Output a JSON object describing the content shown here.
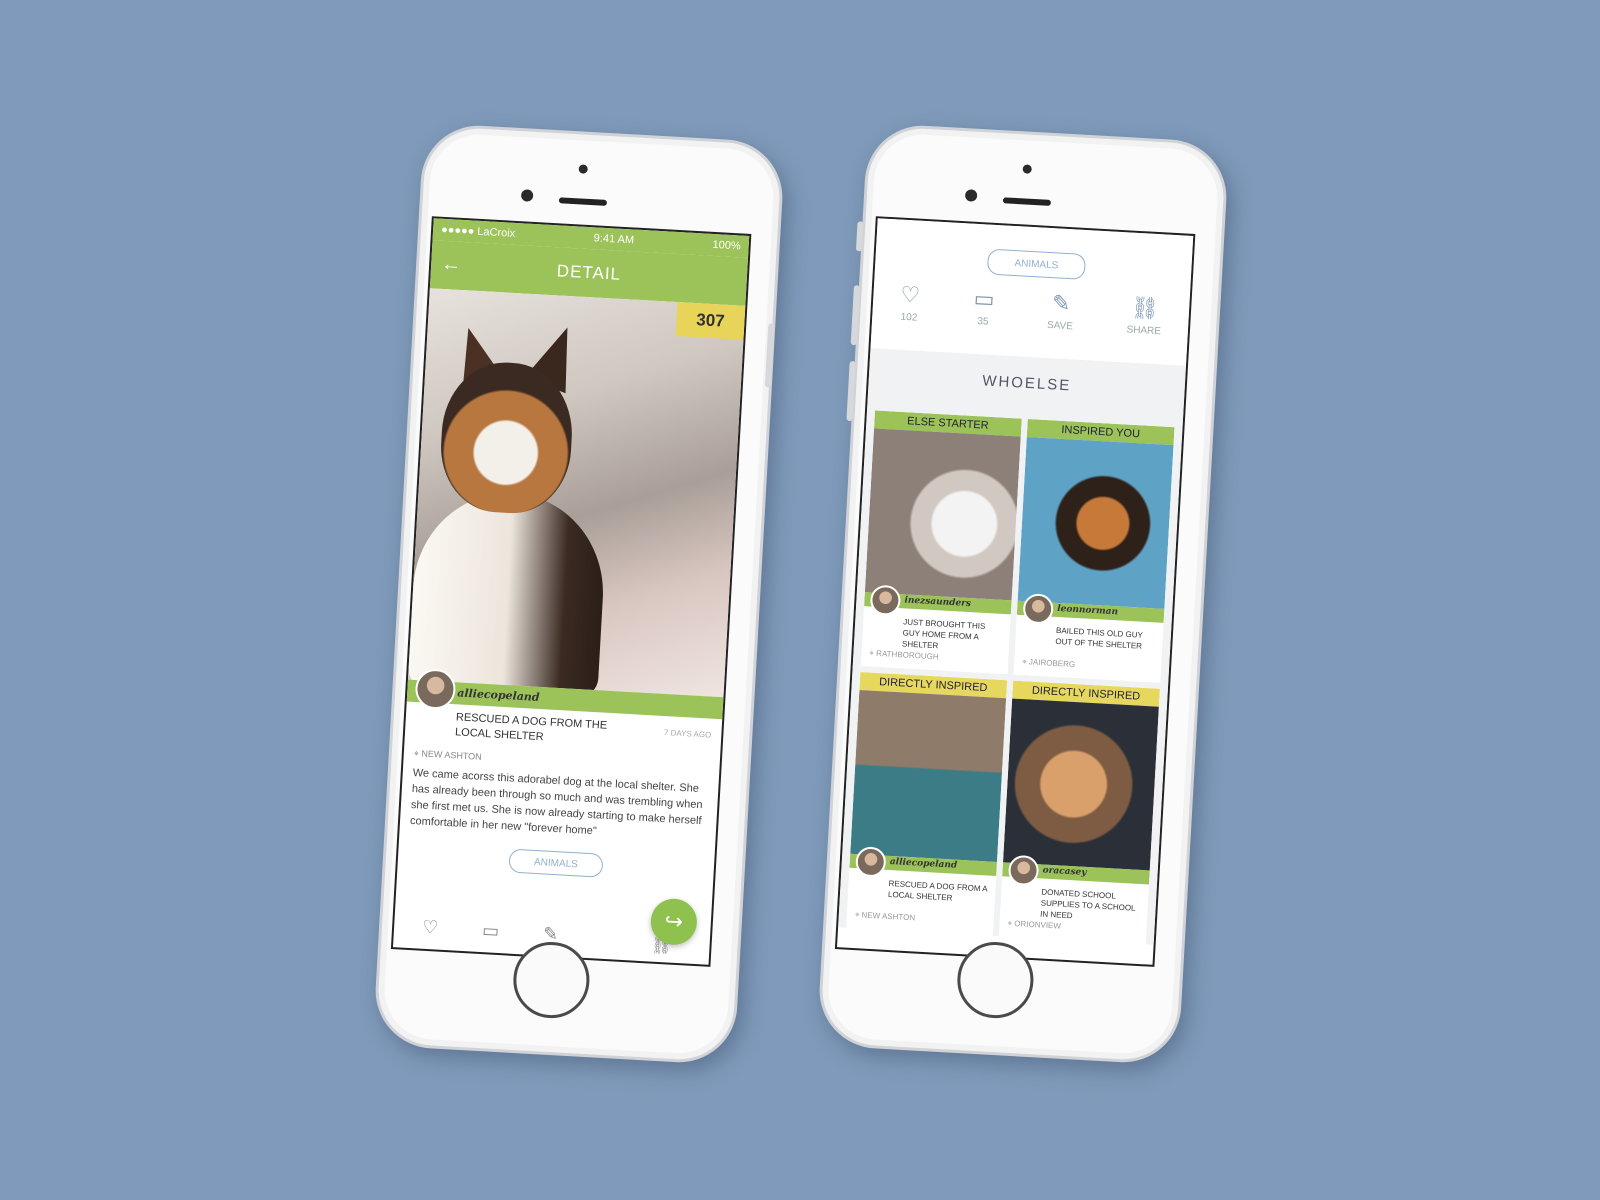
{
  "left_phone": {
    "status": {
      "carrier": "●●●●● LaCroix",
      "time": "9:41 AM",
      "battery": "100%"
    },
    "nav_title": "DETAIL",
    "score": "307",
    "post": {
      "username": "alliecopeland",
      "title": "RESCUED A DOG FROM THE LOCAL SHELTER",
      "time_ago": "7 DAYS AGO",
      "location": "NEW ASHTON",
      "body": "We came acorss this adorabel dog at the local shelter. She has already been through so much and was trembling when she first met us. She is now already starting to make herself comfortable in her new \"forever home\"",
      "tag": "ANIMALS"
    },
    "icons": [
      "heart-icon",
      "comment-icon",
      "pin-icon",
      "share-icon"
    ],
    "fab_icon": "share-arrow-icon"
  },
  "right_phone": {
    "tag": "ANIMALS",
    "actions": [
      {
        "icon": "heart-icon",
        "label": "102"
      },
      {
        "icon": "comment-icon",
        "label": "35"
      },
      {
        "icon": "pin-icon",
        "label": "SAVE"
      },
      {
        "icon": "share-icon",
        "label": "SHARE"
      }
    ],
    "section_title": "WHOELSE",
    "cards": [
      {
        "ribbon": "ELSE STARTER",
        "ribbon_color": "#9cc25a",
        "username": "inezsaunders",
        "desc": "JUST BROUGHT THIS GUY HOME FROM A SHELTER",
        "location": "RATHBOROUGH"
      },
      {
        "ribbon": "INSPIRED YOU",
        "ribbon_color": "#9cc25a",
        "username": "leonnorman",
        "desc": "BAILED THIS OLD GUY OUT OF THE SHELTER",
        "location": "JAIROBERG"
      },
      {
        "ribbon": "DIRECTLY INSPIRED",
        "ribbon_color": "#e6d85e",
        "username": "alliecopeland",
        "desc": "RESCUED A DOG FROM A LOCAL SHELTER",
        "location": "NEW ASHTON"
      },
      {
        "ribbon": "DIRECTLY INSPIRED",
        "ribbon_color": "#e6d85e",
        "username": "oracasey",
        "desc": "DONATED SCHOOL SUPPLIES TO A SCHOOL IN NEED",
        "location": "ORIONVIEW"
      }
    ]
  },
  "colors": {
    "background": "#7f9aba",
    "accent_green": "#9cc25a",
    "accent_yellow": "#e6d85e",
    "pill_blue": "#8fb0d0"
  }
}
